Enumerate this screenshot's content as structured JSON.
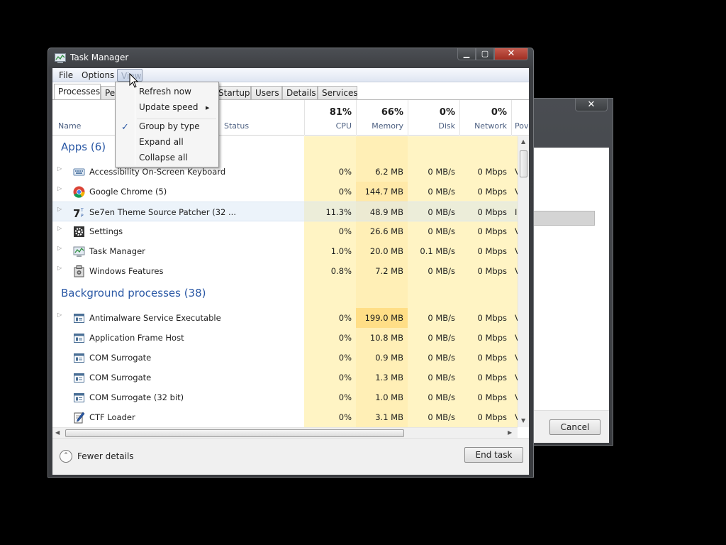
{
  "window": {
    "title": "Task Manager",
    "minimize": "▁",
    "maximize": "▢",
    "close": "✕"
  },
  "menu": {
    "file": "File",
    "options": "Options",
    "view": "View"
  },
  "tabs": [
    "Processes",
    "Pe",
    "Startup",
    "Users",
    "Details",
    "Services"
  ],
  "header": {
    "name": "Name",
    "status": "Status",
    "cpu_pct": "81%",
    "cpu": "CPU",
    "mem_pct": "66%",
    "mem": "Memory",
    "disk_pct": "0%",
    "disk": "Disk",
    "net_pct": "0%",
    "net": "Network",
    "power": "Pov"
  },
  "groups": {
    "apps": "Apps (6)",
    "background": "Background processes (38)"
  },
  "apps": [
    {
      "name": "Accessibility On-Screen Keyboard",
      "cpu": "0%",
      "mem": "6.2 MB",
      "disk": "0 MB/s",
      "net": "0 Mbps",
      "pow": "V",
      "icon": "keyboard-icon"
    },
    {
      "name": "Google Chrome (5)",
      "cpu": "0%",
      "mem": "144.7 MB",
      "disk": "0 MB/s",
      "net": "0 Mbps",
      "pow": "V",
      "icon": "chrome-icon"
    },
    {
      "name": "Se7en Theme Source Patcher (32 ...",
      "cpu": "11.3%",
      "mem": "48.9 MB",
      "disk": "0 MB/s",
      "net": "0 Mbps",
      "pow": "I",
      "icon": "se7en-icon"
    },
    {
      "name": "Settings",
      "cpu": "0%",
      "mem": "26.6 MB",
      "disk": "0 MB/s",
      "net": "0 Mbps",
      "pow": "V",
      "icon": "gear-icon"
    },
    {
      "name": "Task Manager",
      "cpu": "1.0%",
      "mem": "20.0 MB",
      "disk": "0.1 MB/s",
      "net": "0 Mbps",
      "pow": "V",
      "icon": "taskmanager-icon"
    },
    {
      "name": "Windows Features",
      "cpu": "0.8%",
      "mem": "7.2 MB",
      "disk": "0 MB/s",
      "net": "0 Mbps",
      "pow": "V",
      "icon": "windows-features-icon"
    }
  ],
  "background": [
    {
      "name": "Antimalware Service Executable",
      "cpu": "0%",
      "mem": "199.0 MB",
      "disk": "0 MB/s",
      "net": "0 Mbps",
      "pow": "V",
      "icon": "process-icon"
    },
    {
      "name": "Application Frame Host",
      "cpu": "0%",
      "mem": "10.8 MB",
      "disk": "0 MB/s",
      "net": "0 Mbps",
      "pow": "V",
      "icon": "process-icon"
    },
    {
      "name": "COM Surrogate",
      "cpu": "0%",
      "mem": "0.9 MB",
      "disk": "0 MB/s",
      "net": "0 Mbps",
      "pow": "V",
      "icon": "process-icon"
    },
    {
      "name": "COM Surrogate",
      "cpu": "0%",
      "mem": "1.3 MB",
      "disk": "0 MB/s",
      "net": "0 Mbps",
      "pow": "V",
      "icon": "process-icon"
    },
    {
      "name": "COM Surrogate (32 bit)",
      "cpu": "0%",
      "mem": "1.0 MB",
      "disk": "0 MB/s",
      "net": "0 Mbps",
      "pow": "V",
      "icon": "process-icon"
    },
    {
      "name": "CTF Loader",
      "cpu": "0%",
      "mem": "3.1 MB",
      "disk": "0 MB/s",
      "net": "0 Mbps",
      "pow": "V",
      "icon": "ctf-loader-icon"
    }
  ],
  "footer": {
    "fewer": "Fewer details",
    "end_task": "End task"
  },
  "view_menu": {
    "refresh": "Refresh now",
    "update_speed": "Update speed",
    "group_by_type": "Group by type",
    "expand_all": "Expand all",
    "collapse_all": "Collapse all",
    "checked": "Group by type"
  },
  "background_dialog": {
    "close": "✕",
    "cancel": "Cancel"
  },
  "colors": {
    "group_blue": "#2a58a5",
    "heat_light": "#fff4c4",
    "heat_mid": "#ffe9a8",
    "heat_strong": "#ffde86"
  }
}
